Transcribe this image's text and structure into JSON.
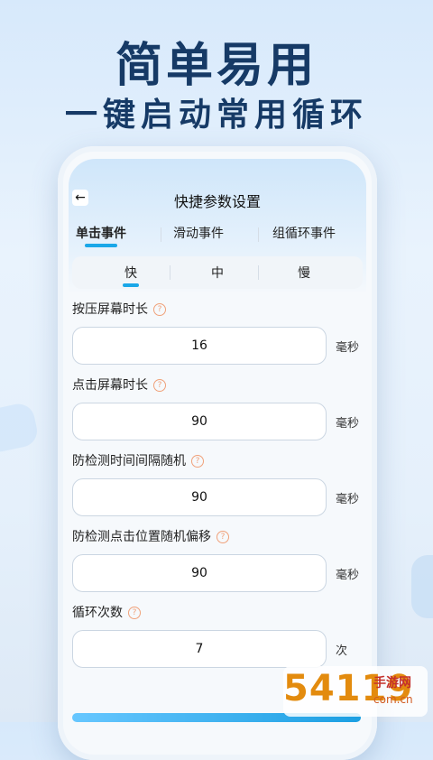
{
  "headline": {
    "title": "简单易用",
    "subtitle": "一键启动常用循环"
  },
  "screen": {
    "title": "快捷参数设置",
    "back_icon": "back-arrow-icon"
  },
  "tabs": [
    {
      "label": "单击事件",
      "active": true
    },
    {
      "label": "滑动事件",
      "active": false
    },
    {
      "label": "组循环事件",
      "active": false
    }
  ],
  "speed": [
    {
      "label": "快",
      "active": true
    },
    {
      "label": "中",
      "active": false
    },
    {
      "label": "慢",
      "active": false
    }
  ],
  "fields": [
    {
      "label": "按压屏幕时长",
      "value": "16",
      "unit": "毫秒",
      "help": "?"
    },
    {
      "label": "点击屏幕时长",
      "value": "90",
      "unit": "毫秒",
      "help": "?"
    },
    {
      "label": "防检测时间间隔随机",
      "value": "90",
      "unit": "毫秒",
      "help": "?"
    },
    {
      "label": "防检测点击位置随机偏移",
      "value": "90",
      "unit": "毫秒",
      "help": "?"
    },
    {
      "label": "循环次数",
      "value": "7",
      "unit": "次",
      "help": "?"
    }
  ],
  "watermark": {
    "main": "54119",
    "side": "手游网",
    "url": "com.cn"
  },
  "colors": {
    "accent": "#1aa7e8",
    "headline": "#163a66",
    "help": "#f0a17a"
  }
}
